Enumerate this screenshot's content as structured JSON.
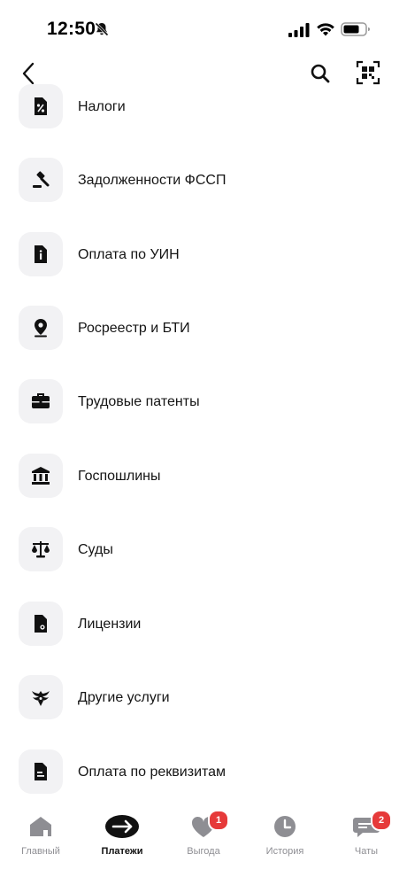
{
  "status_bar": {
    "time": "12:50"
  },
  "list": {
    "items": [
      {
        "label": "Налоги",
        "icon": "percent-doc-icon"
      },
      {
        "label": "Задолженности ФССП",
        "icon": "gavel-icon"
      },
      {
        "label": "Оплата по УИН",
        "icon": "info-doc-icon"
      },
      {
        "label": "Росреестр и БТИ",
        "icon": "location-pin-icon"
      },
      {
        "label": "Трудовые патенты",
        "icon": "briefcase-icon"
      },
      {
        "label": "Госпошлины",
        "icon": "government-building-icon"
      },
      {
        "label": "Суды",
        "icon": "scales-icon"
      },
      {
        "label": "Лицензии",
        "icon": "license-doc-icon"
      },
      {
        "label": "Другие услуги",
        "icon": "double-eagle-icon"
      },
      {
        "label": "Оплата по реквизитам",
        "icon": "requisites-doc-icon"
      }
    ]
  },
  "tab_bar": {
    "tabs": [
      {
        "label": "Главный",
        "icon": "home-icon",
        "active": false
      },
      {
        "label": "Платежи",
        "icon": "payments-arrows-icon",
        "active": true
      },
      {
        "label": "Выгода",
        "icon": "heart-icon",
        "badge": "1",
        "active": false
      },
      {
        "label": "История",
        "icon": "clock-icon",
        "active": false
      },
      {
        "label": "Чаты",
        "icon": "chat-icon",
        "badge": "2",
        "active": false
      }
    ]
  },
  "colors": {
    "accent": "#111111",
    "badge": "#e63a3a",
    "tile": "#f2f2f4",
    "inactive": "#8e8e93"
  }
}
